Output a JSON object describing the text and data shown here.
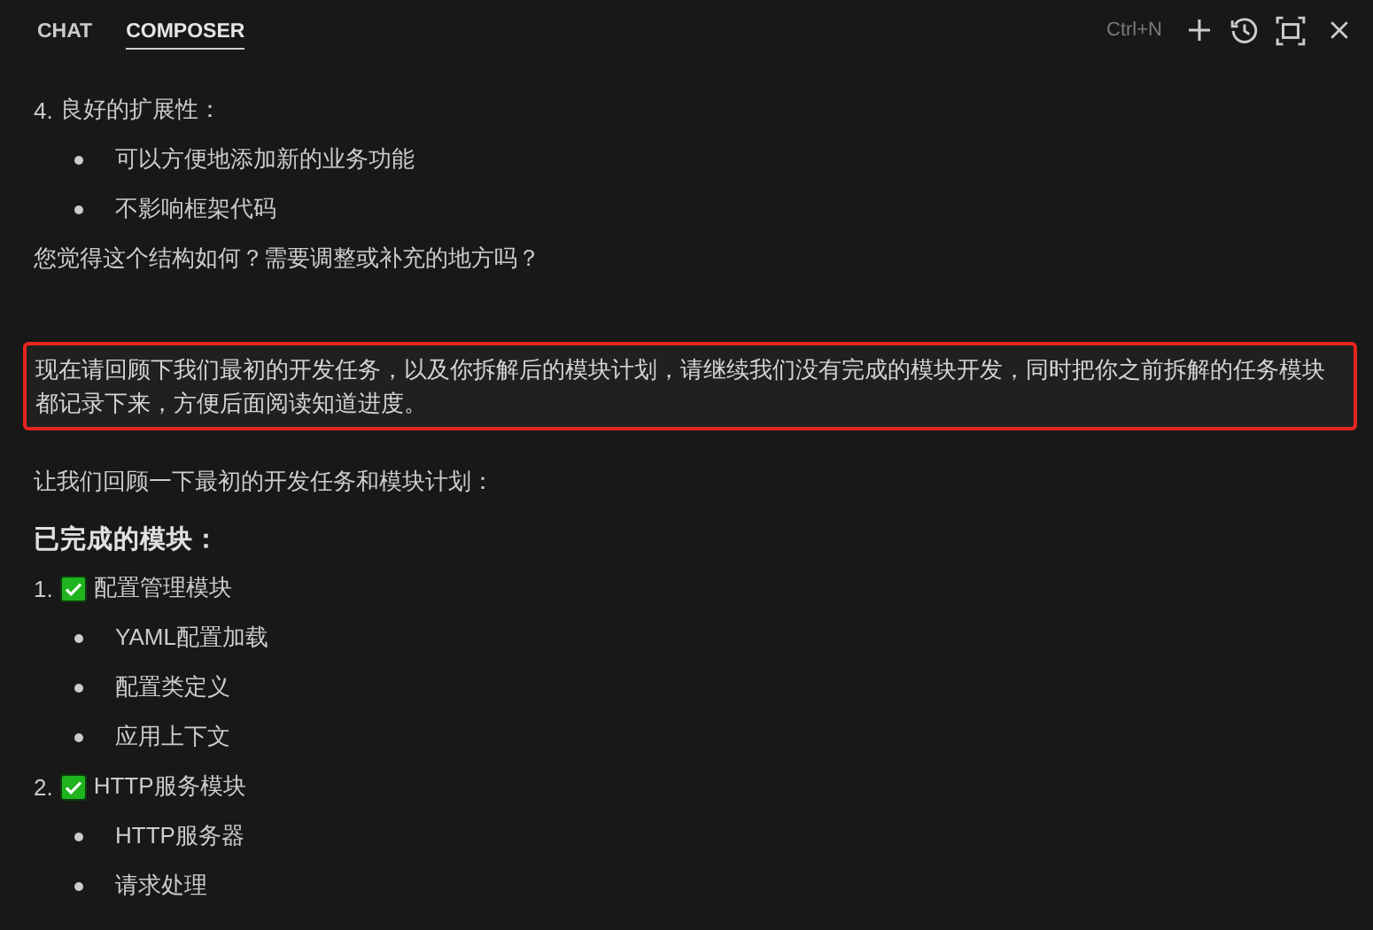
{
  "tabs": [
    {
      "label": "CHAT",
      "selected": false
    },
    {
      "label": "COMPOSER",
      "selected": true
    }
  ],
  "shortcut_hint": "Ctrl+N",
  "content": [
    {
      "kind": "numbered",
      "number": "4.",
      "done": false,
      "text": "良好的扩展性："
    },
    {
      "kind": "bullet",
      "text": "可以方便地添加新的业务功能"
    },
    {
      "kind": "bullet",
      "text": "不影响框架代码"
    },
    {
      "kind": "paragraph",
      "text": "您觉得这个结构如何？需要调整或补充的地方吗？"
    },
    {
      "kind": "user_message",
      "text": "现在请回顾下我们最初的开发任务，以及你拆解后的模块计划，请继续我们没有完成的模块开发，同时把你之前拆解的任务模块都记录下来，方便后面阅读知道进度。"
    },
    {
      "kind": "paragraph",
      "text": "让我们回顾一下最初的开发任务和模块计划："
    },
    {
      "kind": "heading",
      "text": "已完成的模块："
    },
    {
      "kind": "numbered",
      "number": "1.",
      "done": true,
      "text": "配置管理模块"
    },
    {
      "kind": "bullet",
      "text": "YAML配置加载"
    },
    {
      "kind": "bullet",
      "text": "配置类定义"
    },
    {
      "kind": "bullet",
      "text": "应用上下文"
    },
    {
      "kind": "numbered",
      "number": "2.",
      "done": true,
      "text": "HTTP服务模块"
    },
    {
      "kind": "bullet",
      "text": "HTTP服务器"
    },
    {
      "kind": "bullet",
      "text": "请求处理"
    }
  ]
}
